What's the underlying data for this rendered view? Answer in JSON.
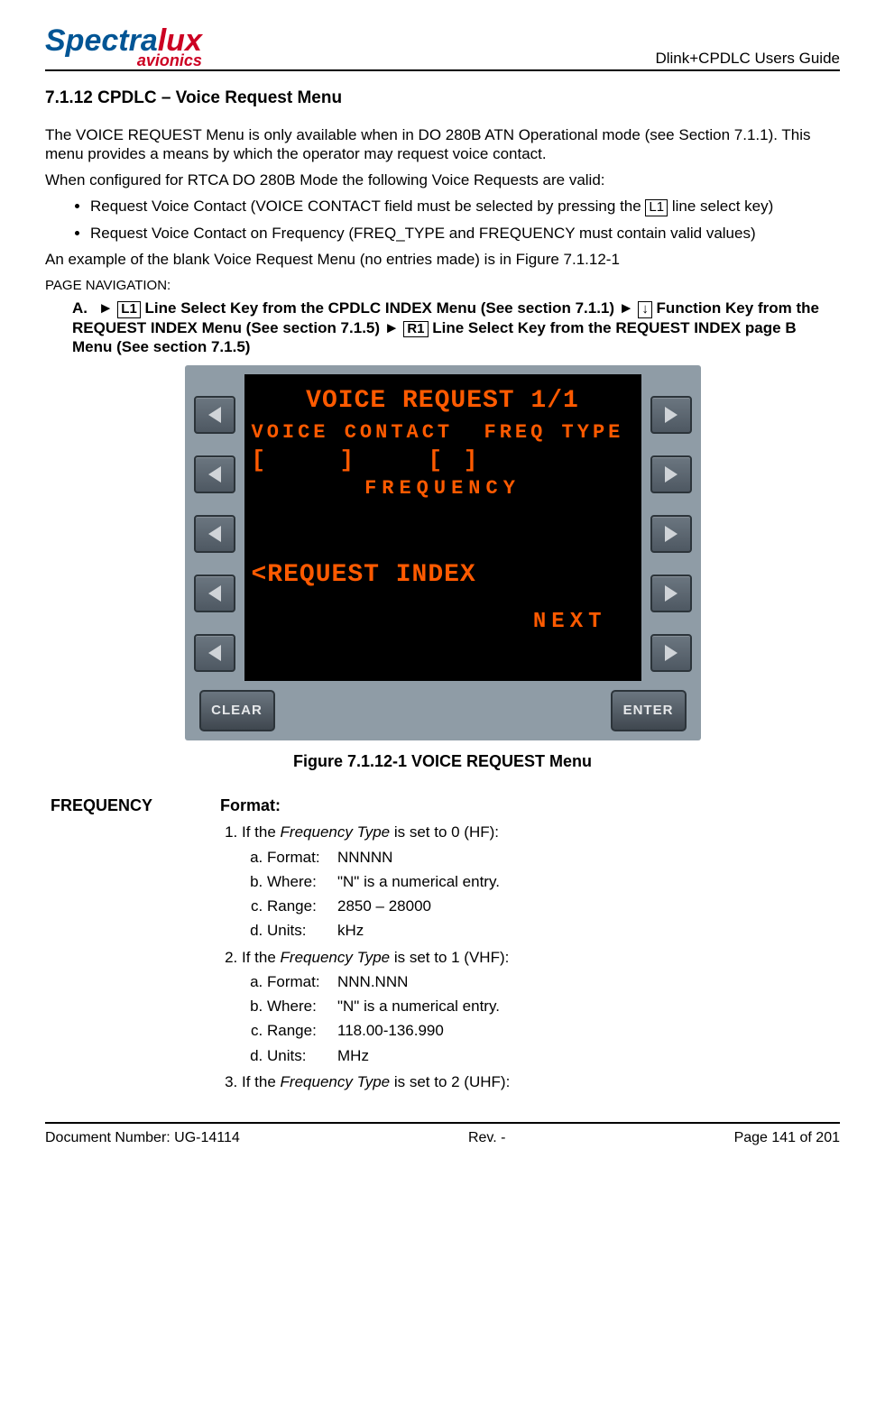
{
  "header": {
    "logo_main_1": "Spectra",
    "logo_main_2": "lux",
    "logo_sub": "avionics",
    "guide": "Dlink+CPDLC Users Guide"
  },
  "section": {
    "number": "7.1.12",
    "title": "CPDLC – Voice Request Menu"
  },
  "body": {
    "p1": "The VOICE REQUEST Menu is only available when in DO 280B ATN Operational mode (see Section 7.1.1). This menu provides a means by which the operator may request voice contact.",
    "p2": "When configured for RTCA DO 280B Mode the following Voice Requests are valid:",
    "bullet1a": "Request Voice Contact (VOICE CONTACT field must be selected by pressing the ",
    "bullet1_key": "L1",
    "bullet1b": " line select key)",
    "bullet2": "Request Voice Contact on Frequency (FREQ_TYPE and FREQUENCY must contain valid values)",
    "p3": "An example of the blank Voice Request Menu (no entries made) is in Figure 7.1.12-1",
    "nav_label": "PAGE NAVIGATION:",
    "nav_letter": "A.",
    "nav_seg1": "► ",
    "nav_key1": "L1",
    "nav_seg2": " Line Select Key from the CPDLC INDEX Menu (See section 7.1.1) ► ",
    "nav_key2": "↓",
    "nav_seg3": " Function Key from the REQUEST INDEX Menu (See section 7.1.5) ► ",
    "nav_key3": "R1",
    "nav_seg4": " Line Select Key from the REQUEST INDEX page B Menu (See section 7.1.5)"
  },
  "mcdu": {
    "title": "VOICE REQUEST  1/1",
    "labels": "VOICE CONTACT  FREQ TYPE",
    "inputs": "[    ]    [ ]",
    "freq_label": "FREQUENCY",
    "req_index": "<REQUEST INDEX",
    "next": "NEXT",
    "clear": "CLEAR",
    "enter": "ENTER"
  },
  "figure_caption": "Figure 7.1.12-1 VOICE REQUEST Menu",
  "spec": {
    "field": "FREQUENCY",
    "format_head": "Format:",
    "item1_intro_a": "If the ",
    "item1_intro_em": "Frequency Type",
    "item1_intro_b": " is set to 0 (HF):",
    "i1": {
      "a_k": "Format:",
      "a_v": "NNNNN",
      "b_k": "Where:",
      "b_v": "\"N\" is a numerical entry.",
      "c_k": "Range:",
      "c_v": "2850 – 28000",
      "d_k": "Units:",
      "d_v": "kHz"
    },
    "item2_intro_a": "If the ",
    "item2_intro_em": "Frequency Type",
    "item2_intro_b": " is set to 1 (VHF):",
    "i2": {
      "a_k": "Format:",
      "a_v": "NNN.NNN",
      "b_k": "Where:",
      "b_v": "\"N\" is a numerical entry.",
      "c_k": "Range:",
      "c_v": "118.00-136.990",
      "d_k": "Units:",
      "d_v": "MHz"
    },
    "item3_intro_a": "If the ",
    "item3_intro_em": "Frequency Type",
    "item3_intro_b": " is set to 2 (UHF):"
  },
  "footer": {
    "left": "Document Number:  UG-14114",
    "center": "Rev. -",
    "right": "Page 141 of 201"
  }
}
